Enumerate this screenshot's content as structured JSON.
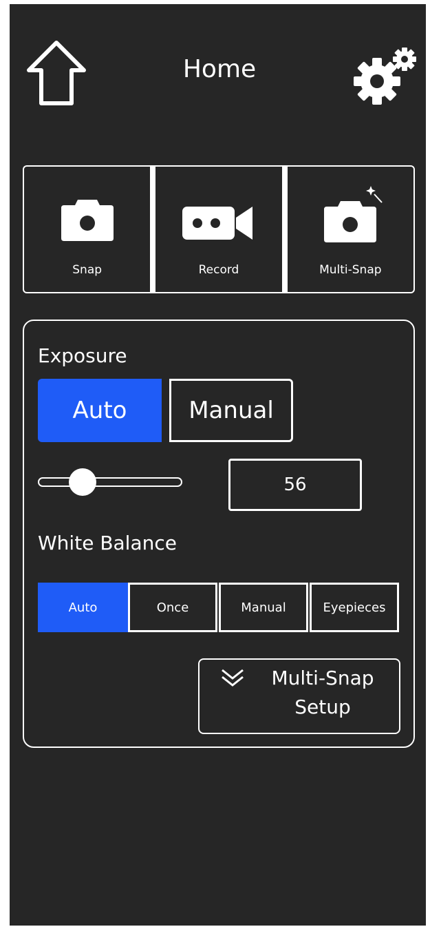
{
  "header": {
    "title": "Home",
    "left_icon": "home-icon",
    "right_icon": "gear-icon"
  },
  "capture": {
    "buttons": [
      {
        "label": "Snap",
        "icon": "camera-icon"
      },
      {
        "label": "Record",
        "icon": "video-camera-icon"
      },
      {
        "label": "Multi-Snap",
        "icon": "camera-sparkle-icon"
      }
    ]
  },
  "exposure": {
    "title": "Exposure",
    "modes": [
      "Auto",
      "Manual"
    ],
    "selected_mode": "Auto",
    "slider_fraction": 0.22,
    "value": "56"
  },
  "white_balance": {
    "title": "White Balance",
    "modes": [
      "Auto",
      "Once",
      "Manual",
      "Eyepieces"
    ],
    "selected_mode": "Auto"
  },
  "multi_snap_setup": {
    "label": "Multi-Snap Setup",
    "icon": "double-chevron-down-icon"
  },
  "colors": {
    "background": "#262626",
    "accent": "#1f5cf7",
    "foreground": "#ffffff"
  }
}
